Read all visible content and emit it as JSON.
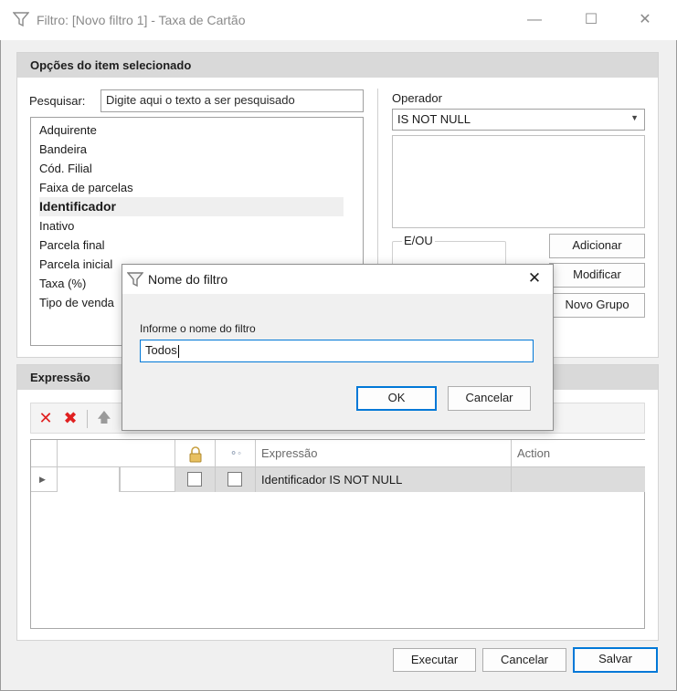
{
  "window": {
    "title": "Filtro: [Novo filtro 1] - Taxa de Cartão",
    "minimize": "—",
    "maximize": "☐",
    "close": "✕"
  },
  "options_panel": {
    "header": "Opções do item selecionado",
    "search_label": "Pesquisar:",
    "search_placeholder": "Digite aqui o texto a ser pesquisado",
    "fields": [
      "Adquirente",
      "Bandeira",
      "Cód. Filial",
      "Faixa de parcelas",
      "Identificador",
      "Inativo",
      "Parcela final",
      "Parcela inicial",
      "Taxa (%)",
      "Tipo de venda"
    ],
    "selected_field": "Identificador",
    "operator_label": "Operador",
    "operator_value": "IS NOT NULL",
    "eou_label": "E/OU",
    "add_button": "Adicionar",
    "modify_button": "Modificar",
    "new_group_button": "Novo Grupo"
  },
  "expression_panel": {
    "header": "Expressão",
    "columns": [
      "Expressão",
      "Action"
    ],
    "rows": [
      {
        "expression": "Identificador IS NOT NULL",
        "action": ""
      }
    ]
  },
  "footer": {
    "execute_button": "Executar",
    "cancel_button": "Cancelar",
    "save_button": "Salvar"
  },
  "dialog": {
    "title": "Nome do filtro",
    "prompt": "Informe o nome do filtro",
    "input_value": "Todos",
    "ok_button": "OK",
    "cancel_button": "Cancelar",
    "close": "✕"
  },
  "colors": {
    "accent": "#0078d7",
    "panel_header": "#d9d9d9",
    "delete_red": "#e02020"
  }
}
